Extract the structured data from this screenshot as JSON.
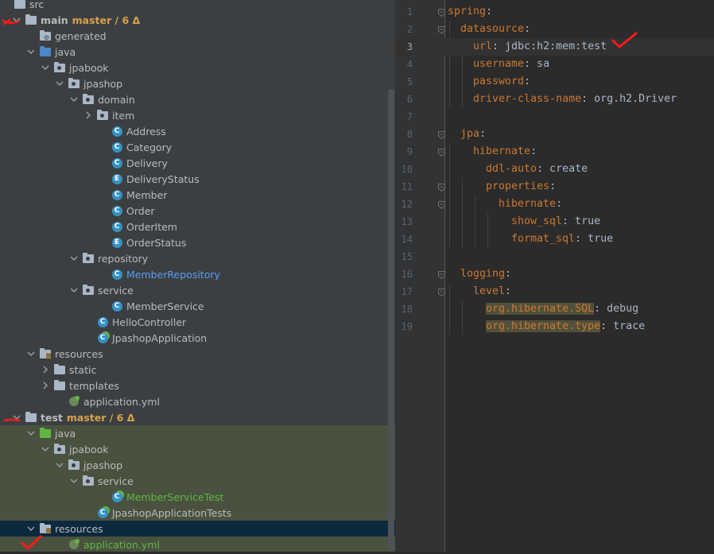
{
  "project_tree": {
    "rows": [
      {
        "label": "src",
        "icon": "folder-icon"
      },
      {
        "label": "main",
        "branch": "master / 6 Δ",
        "icon": "folder-icon"
      },
      {
        "label": "generated",
        "icon": "generated-folder-icon"
      },
      {
        "label": "java",
        "icon": "source-folder-icon"
      },
      {
        "label": "jpabook",
        "icon": "package-icon"
      },
      {
        "label": "jpashop",
        "icon": "package-icon"
      },
      {
        "label": "domain",
        "icon": "package-icon"
      },
      {
        "label": "item",
        "icon": "package-icon"
      },
      {
        "label": "Address",
        "icon": "class-icon",
        "badge": "C"
      },
      {
        "label": "Category",
        "icon": "class-icon",
        "badge": "C"
      },
      {
        "label": "Delivery",
        "icon": "class-icon",
        "badge": "C"
      },
      {
        "label": "DeliveryStatus",
        "icon": "enum-icon",
        "badge": "E"
      },
      {
        "label": "Member",
        "icon": "class-icon",
        "badge": "C"
      },
      {
        "label": "Order",
        "icon": "class-icon",
        "badge": "C"
      },
      {
        "label": "OrderItem",
        "icon": "class-icon",
        "badge": "C"
      },
      {
        "label": "OrderStatus",
        "icon": "enum-icon",
        "badge": "E"
      },
      {
        "label": "repository",
        "icon": "package-icon"
      },
      {
        "label": "MemberRepository",
        "icon": "class-icon",
        "badge": "C"
      },
      {
        "label": "service",
        "icon": "package-icon"
      },
      {
        "label": "MemberService",
        "icon": "class-icon",
        "badge": "C"
      },
      {
        "label": "HelloController",
        "icon": "class-icon",
        "badge": "C"
      },
      {
        "label": "JpashopApplication",
        "icon": "spring-boot-class-icon",
        "badge": "C"
      },
      {
        "label": "resources",
        "icon": "resources-folder-icon"
      },
      {
        "label": "static",
        "icon": "folder-icon"
      },
      {
        "label": "templates",
        "icon": "folder-icon"
      },
      {
        "label": "application.yml",
        "icon": "spring-config-icon"
      },
      {
        "label": "test",
        "branch": "master / 6 Δ",
        "icon": "folder-icon"
      },
      {
        "label": "java",
        "icon": "test-source-folder-icon"
      },
      {
        "label": "jpabook",
        "icon": "package-icon"
      },
      {
        "label": "jpashop",
        "icon": "package-icon"
      },
      {
        "label": "service",
        "icon": "package-icon"
      },
      {
        "label": "MemberServiceTest",
        "icon": "test-class-icon",
        "badge": "C"
      },
      {
        "label": "JpashopApplicationTests",
        "icon": "test-class-icon",
        "badge": "C"
      },
      {
        "label": "resources",
        "icon": "resources-folder-icon"
      },
      {
        "label": "application.yml",
        "icon": "spring-config-icon"
      }
    ]
  },
  "editor": {
    "file": "application.yml",
    "current_line": 3,
    "lines": [
      {
        "n": "1",
        "parts": [
          {
            "t": "spring",
            "c": "key"
          },
          {
            "t": ":",
            "c": "val"
          }
        ]
      },
      {
        "n": "2",
        "parts": [
          {
            "t": "datasource",
            "c": "key"
          },
          {
            "t": ":",
            "c": "val"
          }
        ]
      },
      {
        "n": "3",
        "parts": [
          {
            "t": "url",
            "c": "key"
          },
          {
            "t": ": jdbc:h2:mem:test",
            "c": "val"
          }
        ]
      },
      {
        "n": "4",
        "parts": [
          {
            "t": "username",
            "c": "key"
          },
          {
            "t": ": sa",
            "c": "val"
          }
        ]
      },
      {
        "n": "5",
        "parts": [
          {
            "t": "password",
            "c": "key"
          },
          {
            "t": ":",
            "c": "val"
          }
        ]
      },
      {
        "n": "6",
        "parts": [
          {
            "t": "driver-class-name",
            "c": "key"
          },
          {
            "t": ": org.h2.Driver",
            "c": "val"
          }
        ]
      },
      {
        "n": "7",
        "parts": []
      },
      {
        "n": "8",
        "parts": [
          {
            "t": "jpa",
            "c": "key"
          },
          {
            "t": ":",
            "c": "val"
          }
        ]
      },
      {
        "n": "9",
        "parts": [
          {
            "t": "hibernate",
            "c": "key"
          },
          {
            "t": ":",
            "c": "val"
          }
        ]
      },
      {
        "n": "10",
        "parts": [
          {
            "t": "ddl-auto",
            "c": "key"
          },
          {
            "t": ": create",
            "c": "val"
          }
        ]
      },
      {
        "n": "11",
        "parts": [
          {
            "t": "properties",
            "c": "key"
          },
          {
            "t": ":",
            "c": "val"
          }
        ]
      },
      {
        "n": "12",
        "parts": [
          {
            "t": "hibernate",
            "c": "key"
          },
          {
            "t": ":",
            "c": "val"
          }
        ]
      },
      {
        "n": "13",
        "parts": [
          {
            "t": "show_sql",
            "c": "key"
          },
          {
            "t": ": true",
            "c": "val"
          }
        ]
      },
      {
        "n": "14",
        "parts": [
          {
            "t": "format_sql",
            "c": "key"
          },
          {
            "t": ": true",
            "c": "val"
          }
        ]
      },
      {
        "n": "15",
        "parts": []
      },
      {
        "n": "16",
        "parts": [
          {
            "t": "logging",
            "c": "key"
          },
          {
            "t": ":",
            "c": "val"
          }
        ]
      },
      {
        "n": "17",
        "parts": [
          {
            "t": "level",
            "c": "key"
          },
          {
            "t": ":",
            "c": "val"
          }
        ]
      },
      {
        "n": "18",
        "parts": [
          {
            "t": "org.hibernate.SQL",
            "c": "key-hl"
          },
          {
            "t": ": debug",
            "c": "val"
          }
        ]
      },
      {
        "n": "19",
        "parts": [
          {
            "t": "org.hibernate.type",
            "c": "key-hl"
          },
          {
            "t": ": trace",
            "c": "val"
          }
        ]
      }
    ]
  },
  "colors": {
    "panel_bg": "#3c3f41",
    "editor_bg": "#2b2b2b",
    "yaml_key": "#cc7832",
    "yaml_value": "#a9b7c6",
    "class_badge": "#3592c4",
    "vcs_branch": "#d8a24c",
    "test_green": "#62b543",
    "annotation_red": "#ff1a1a"
  }
}
